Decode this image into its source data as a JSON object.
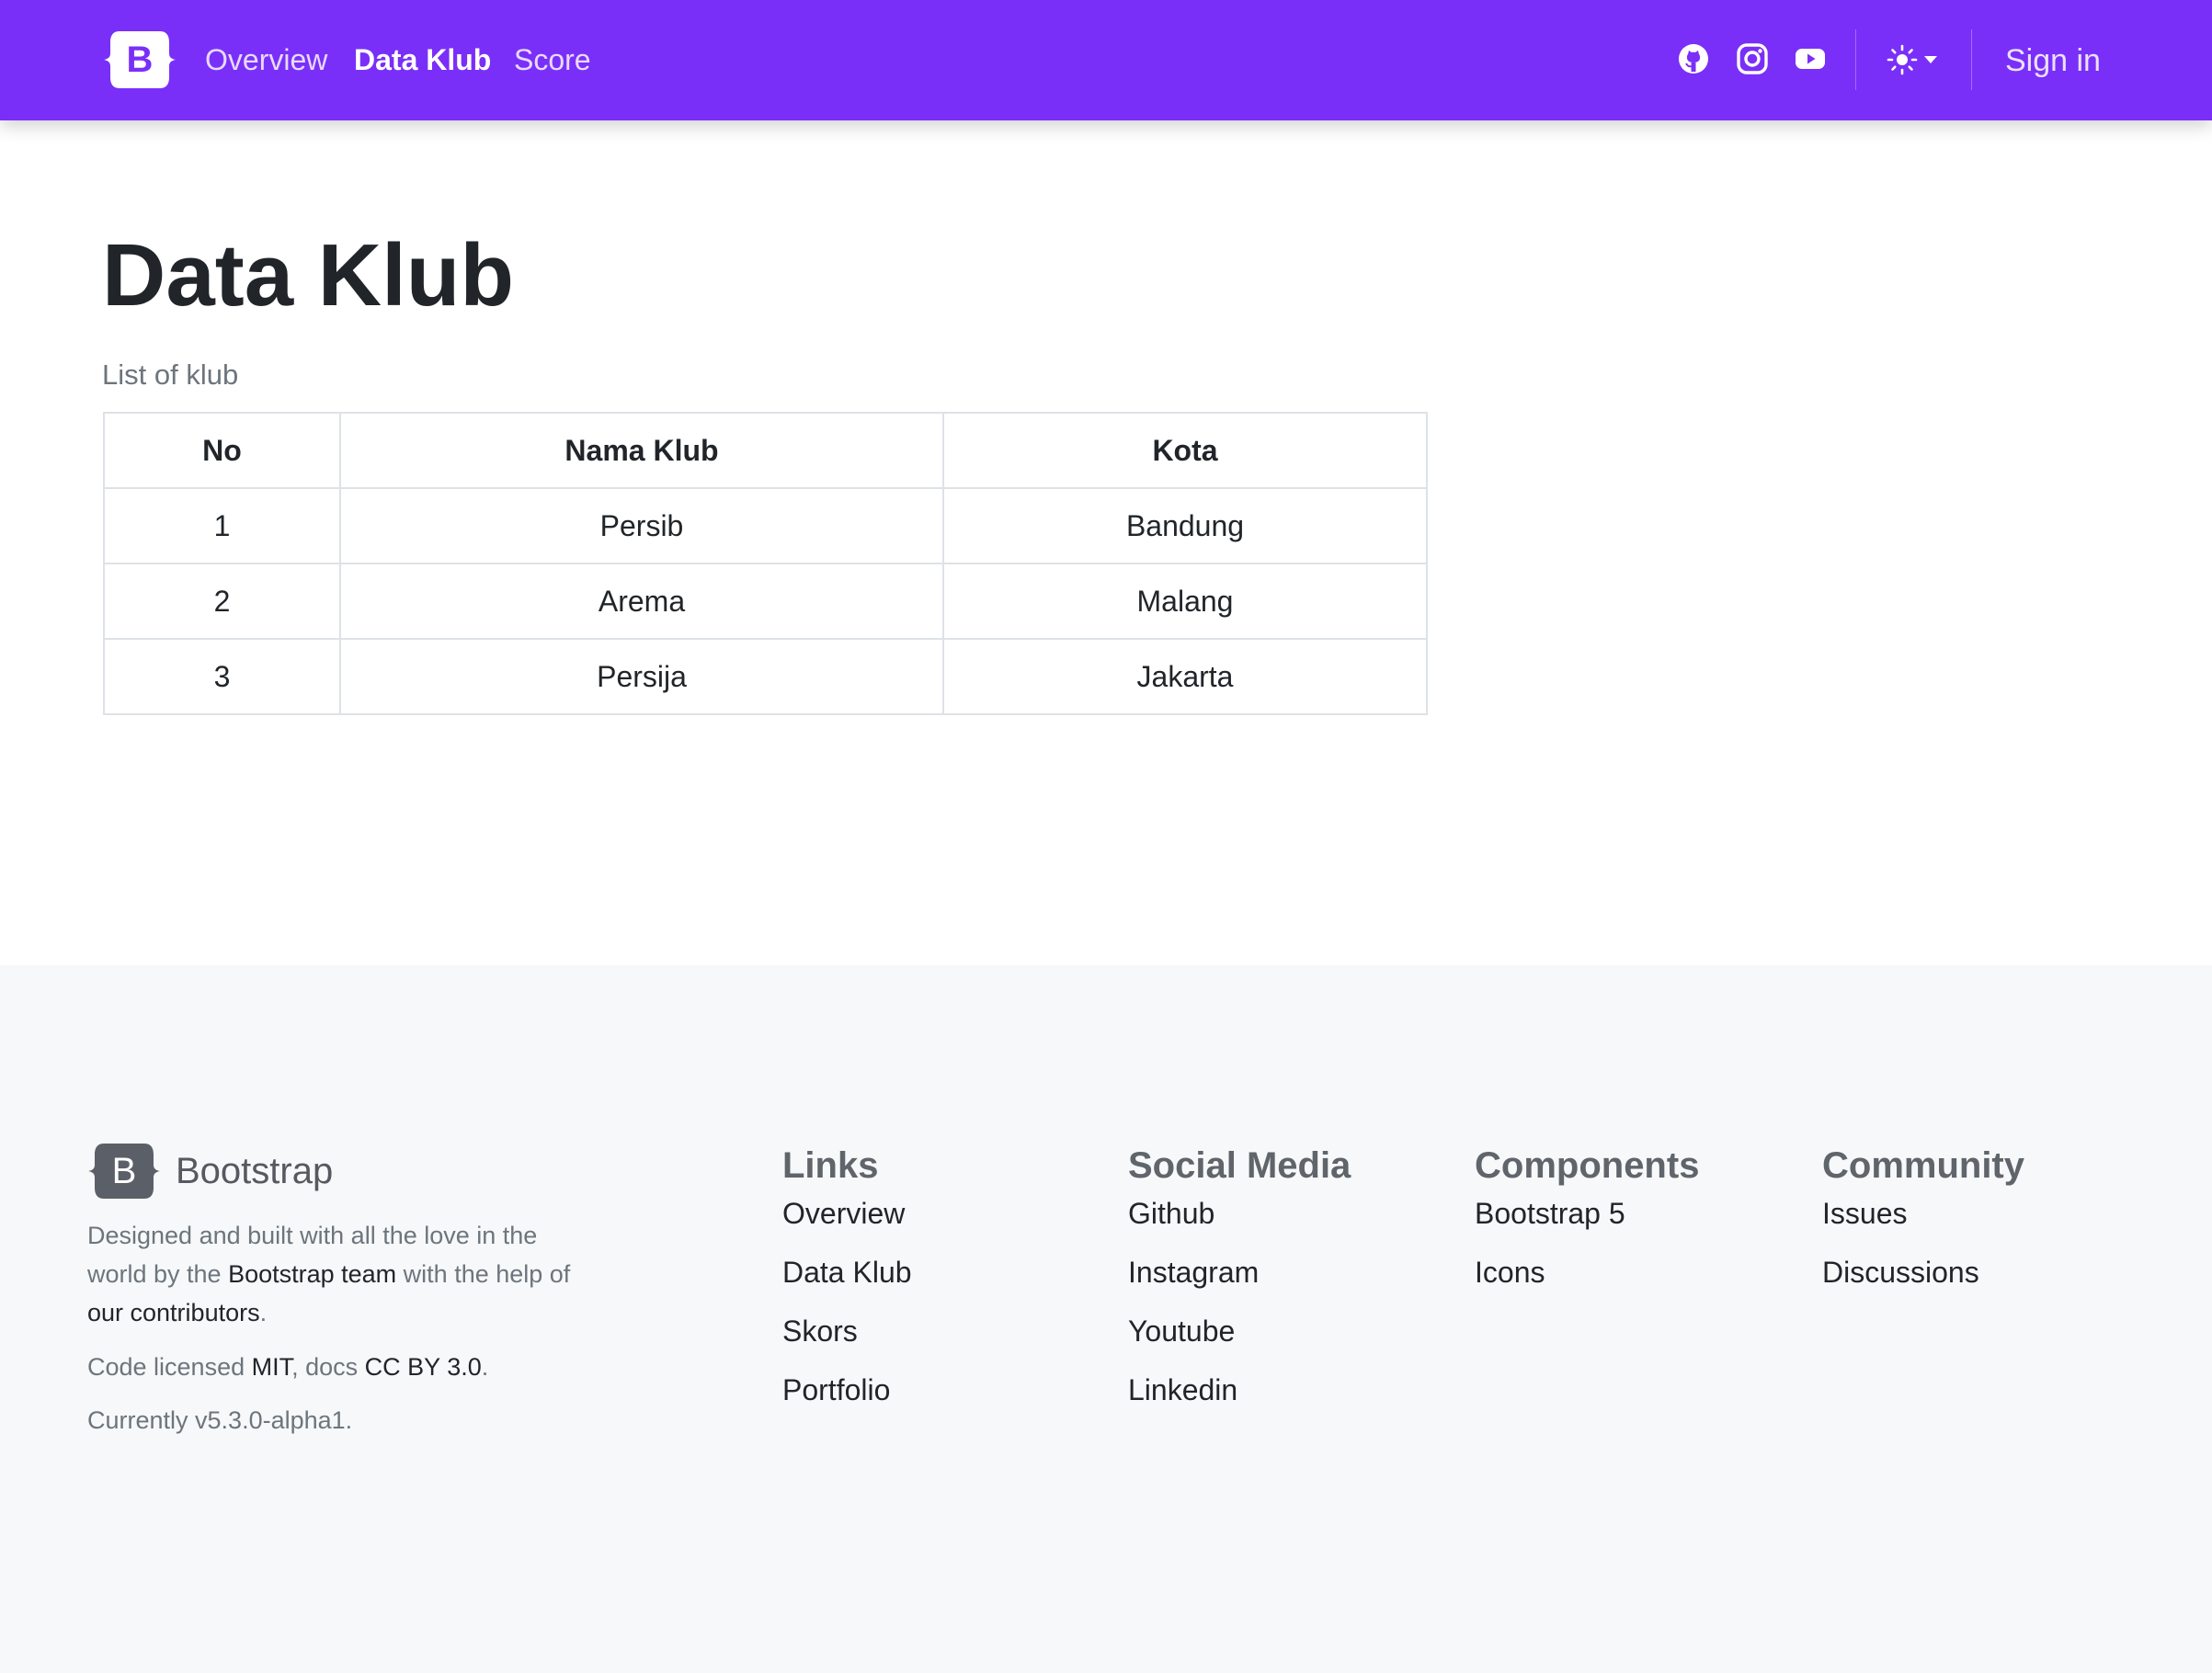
{
  "colors": {
    "navbar_bg": "#7a2ff8",
    "footer_bg": "#f7f8f9",
    "text": "#212529",
    "muted": "#6c757d"
  },
  "navbar": {
    "brand_icon": "bootstrap-logo-icon",
    "brand_letter": "B",
    "links": [
      {
        "label": "Overview",
        "active": false
      },
      {
        "label": "Data Klub",
        "active": true
      },
      {
        "label": "Score",
        "active": false
      }
    ],
    "social_icons": [
      "github-icon",
      "instagram-icon",
      "youtube-icon"
    ],
    "theme_icon": "sun-icon",
    "sign_in_label": "Sign in"
  },
  "main": {
    "title": "Data Klub",
    "caption": "List of klub",
    "table": {
      "headers": [
        "No",
        "Nama Klub",
        "Kota"
      ],
      "rows": [
        [
          "1",
          "Persib",
          "Bandung"
        ],
        [
          "2",
          "Arema",
          "Malang"
        ],
        [
          "3",
          "Persija",
          "Jakarta"
        ]
      ]
    }
  },
  "footer": {
    "brand_name": "Bootstrap",
    "desc_1": "Designed and built with all the love in the world by the ",
    "desc_link_1": "Bootstrap team",
    "desc_2": " with the help of ",
    "desc_link_2": "our contributors",
    "desc_3": ".",
    "license_prefix": "Code licensed ",
    "license_mit": "MIT",
    "license_mid": ", docs ",
    "license_cc": "CC BY 3.0",
    "license_suffix": ".",
    "version": "Currently v5.3.0-alpha1.",
    "columns": [
      {
        "title": "Links",
        "items": [
          "Overview",
          "Data Klub",
          "Skors",
          "Portfolio"
        ]
      },
      {
        "title": "Social Media",
        "items": [
          "Github",
          "Instagram",
          "Youtube",
          "Linkedin"
        ]
      },
      {
        "title": "Components",
        "items": [
          "Bootstrap 5",
          "Icons"
        ]
      },
      {
        "title": "Community",
        "items": [
          "Issues",
          "Discussions"
        ]
      }
    ]
  }
}
